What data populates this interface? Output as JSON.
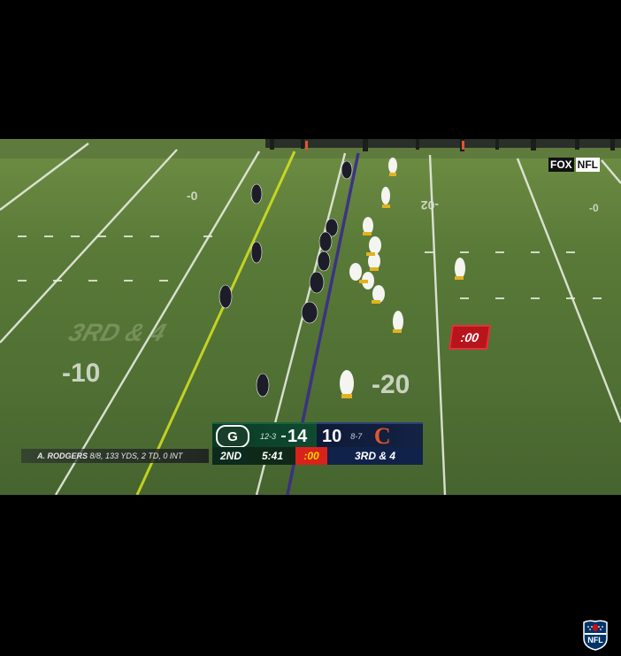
{
  "broadcast": {
    "network_fox": "FOX",
    "network_nfl": "NFL",
    "field_play_clock": ":00",
    "field_marks": {
      "yard_left_top": "-0",
      "yard_mid_top": "-02",
      "yard_right_top": "-0",
      "yard_left_mid": "-10",
      "yard_right_mid": "-20",
      "down_graphic": "3RD & 4"
    }
  },
  "scorebug": {
    "away": {
      "logo": "G",
      "record": "12-3",
      "score": "14"
    },
    "home": {
      "score": "10",
      "record": "8-7",
      "logo": "C"
    },
    "quarter": "2ND",
    "game_clock": "5:41",
    "play_clock": ":00",
    "down_distance": "3RD & 4"
  },
  "stat_line": {
    "player": "A. RODGERS",
    "stats": "8/8, 133 YDS, 2 TD, 0 INT"
  },
  "corner_logo": {
    "text": "NFL"
  },
  "colors": {
    "packers_green": "#0f4b30",
    "bears_navy": "#142244",
    "bears_orange": "#e0562b",
    "play_clock_red": "#d8231b",
    "first_down_line": "#d7e41f",
    "line_of_scrimmage": "#3a2b8c"
  }
}
